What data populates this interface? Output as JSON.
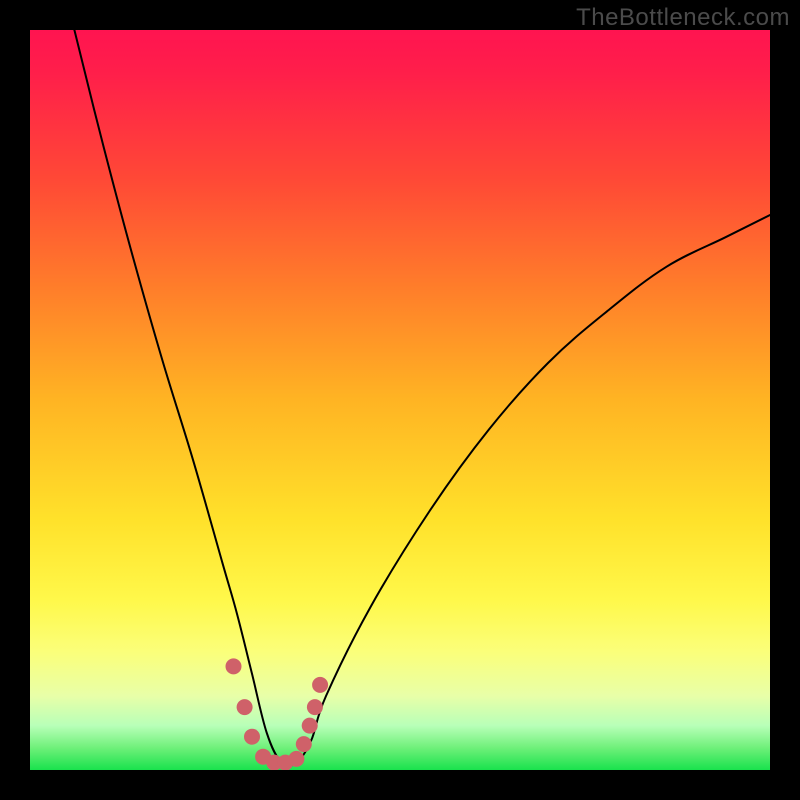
{
  "watermark": "TheBottleneck.com",
  "colors": {
    "background_black": "#000000",
    "watermark_text": "#4b4b4b",
    "curve_stroke": "#000000",
    "marker_fill": "#cf6169",
    "gradient_top": "#ff1450",
    "gradient_mid": "#ffe12a",
    "gradient_bottom": "#19e24d"
  },
  "chart_data": {
    "type": "line",
    "title": "",
    "xlabel": "",
    "ylabel": "",
    "xlim": [
      0,
      100
    ],
    "ylim": [
      0,
      100
    ],
    "grid": false,
    "note": "x = normalized horizontal position (0 left → 100 right); y = bottleneck % (0 = no bottleneck at bottom, 100 = max bottleneck at top). Curve shape is a V with minimum near x≈34.",
    "series": [
      {
        "name": "bottleneck-curve",
        "x": [
          6,
          10,
          14,
          18,
          22,
          26,
          28,
          30,
          32,
          34,
          36,
          38,
          40,
          46,
          54,
          62,
          70,
          78,
          86,
          94,
          100
        ],
        "y": [
          100,
          84,
          69,
          55,
          42,
          28,
          21,
          13,
          5,
          1,
          1,
          4,
          10,
          22,
          35,
          46,
          55,
          62,
          68,
          72,
          75
        ]
      }
    ],
    "markers": {
      "name": "highlight-dots",
      "note": "salmon-colored dots clustered at the bottom of the V",
      "x": [
        27.5,
        29.0,
        30.0,
        31.5,
        33.0,
        34.5,
        36.0,
        37.0,
        37.8,
        38.5,
        39.2
      ],
      "y": [
        14.0,
        8.5,
        4.5,
        1.8,
        1.0,
        1.0,
        1.5,
        3.5,
        6.0,
        8.5,
        11.5
      ]
    }
  }
}
